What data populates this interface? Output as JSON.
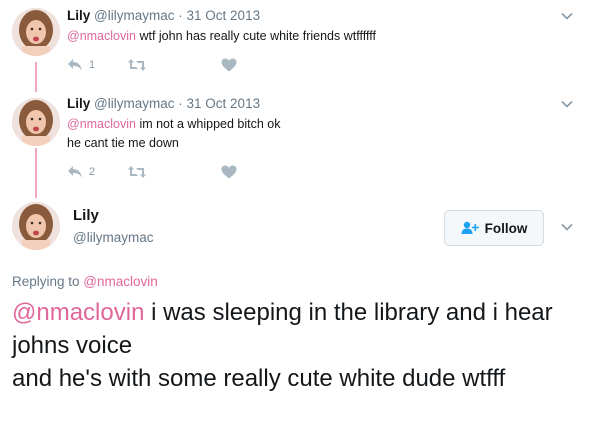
{
  "colors": {
    "accent": "#e0679a",
    "thread_line": "#f4a7bb",
    "muted": "#657786"
  },
  "tweets": [
    {
      "name": "Lily",
      "handle": "@lilymaymac",
      "separator": "·",
      "date": "31 Oct 2013",
      "mention": "@nmaclovin",
      "text": " wtf john has really cute white friends wtffffff",
      "reply_count": "1",
      "retweet_count": "",
      "like_count": ""
    },
    {
      "name": "Lily",
      "handle": "@lilymaymac",
      "separator": "·",
      "date": "31 Oct 2013",
      "mention": "@nmaclovin",
      "text_line1": " im not a whipped bitch ok",
      "text_line2": "he cant tie me down",
      "reply_count": "2",
      "retweet_count": "",
      "like_count": ""
    }
  ],
  "main_tweet": {
    "name": "Lily",
    "handle": "@lilymaymac",
    "follow_label": "Follow",
    "replying_prefix": "Replying to ",
    "replying_to": "@nmaclovin",
    "mention": "@nmaclovin",
    "text_line1": " i was sleeping in the library and i hear johns voice",
    "text_line2": "and he's with some really cute white dude wtfff"
  },
  "icons": {
    "reply": "reply-icon",
    "retweet": "retweet-icon",
    "like": "heart-icon",
    "more": "chevron-down-icon",
    "follow": "add-user-icon"
  }
}
